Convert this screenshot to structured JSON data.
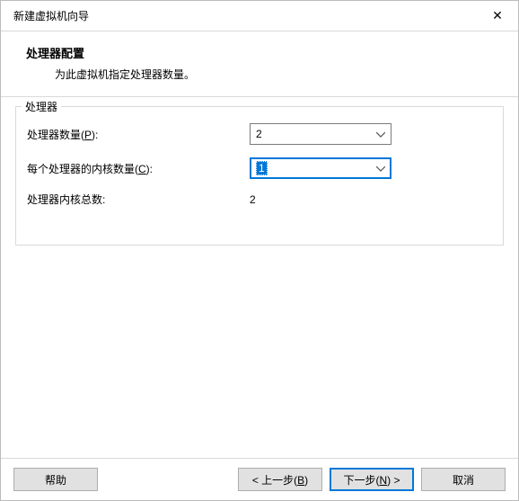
{
  "window": {
    "title": "新建虚拟机向导",
    "close_glyph": "✕"
  },
  "header": {
    "heading": "处理器配置",
    "sub": "为此虚拟机指定处理器数量。"
  },
  "group": {
    "legend": "处理器"
  },
  "rows": {
    "processors": {
      "label_pre": "处理器数量(",
      "mnemonic": "P",
      "label_post": "):",
      "value": "2"
    },
    "cores": {
      "label_pre": "每个处理器的内核数量(",
      "mnemonic": "C",
      "label_post": "):",
      "value": "1"
    },
    "total": {
      "label": "处理器内核总数:",
      "value": "2"
    }
  },
  "buttons": {
    "help": {
      "label": "帮助"
    },
    "back": {
      "pre": "< 上一步(",
      "mn": "B",
      "post": ")"
    },
    "next": {
      "pre": "下一步(",
      "mn": "N",
      "post": ") >"
    },
    "cancel": {
      "label": "取消"
    }
  }
}
